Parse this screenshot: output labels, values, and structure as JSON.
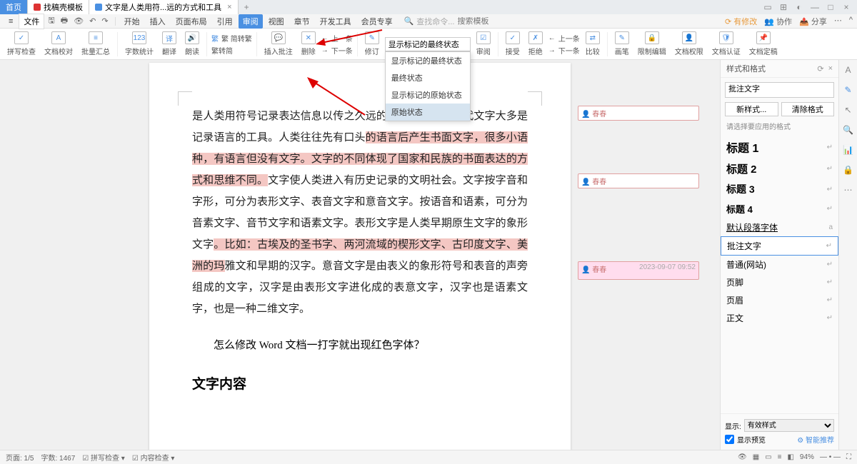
{
  "tabs": {
    "home": "首页",
    "t1": "找稿壳模板",
    "t2": "文字是人类用符...远的方式和工具"
  },
  "menu": {
    "file": "文件",
    "items": [
      "开始",
      "插入",
      "页面布局",
      "引用",
      "审阅",
      "视图",
      "章节",
      "开发工具",
      "会员专享"
    ],
    "active_index": 4,
    "search_label": "查找命令...",
    "search_placeholder": "搜索模板",
    "right": {
      "unsaved": "有修改",
      "coop": "协作",
      "share": "分享"
    }
  },
  "ribbon": {
    "g1": "拼写检查",
    "g2": "文档校对",
    "g3": "批量汇总",
    "g4": "字数统计",
    "g5": "翻译",
    "g6": "朗读",
    "simp": "繁 简转繁",
    "trad": "繁转简",
    "insert_comment": "插入批注",
    "delete": "删除",
    "prev": "上一条",
    "next": "下一条",
    "modify": "修订",
    "show_final_markup": "显示标记的最终状态",
    "review": "审阅",
    "accept": "接受",
    "reject": "拒绝",
    "prev2": "上一条",
    "next2": "下一条",
    "compare": "比较",
    "pen": "画笔",
    "restrict": "限制编辑",
    "perm": "文档权限",
    "auth": "文档认证",
    "anchor": "文档定稿"
  },
  "dropdown": {
    "i1": "显示标记的最终状态",
    "i2": "最终状态",
    "i3": "显示标记的原始状态",
    "i4": "原始状态"
  },
  "doc": {
    "p1a": "是人类用符号记录表达信息以传之久远的方式和工具。现代文字大多是记录语言的工具。人类往往先有口头",
    "p1b": "的语言后产生书面文字，很多小语种，有语言但没有文字。文字的不同体现了国家和民族的书面表达的方式和思维不同。",
    "p1c": "文字使人类进入有历史记录的文明社会。文字按字音和字形，可分为表形文字、表音文字和意音文字。按语音和语素，可分为音素文字、音节文字和语素文字。表形文字是人类早期原生文字的象形文字",
    "p1d": "。比如：古埃及的圣书字、两河流域的楔形文字、古印度文字、美洲的玛",
    "p1e": "雅文和早期的汉字。意音文字是由表义的象形符号和表音的声旁组成的文字，汉字是由表形文字进化成的表意文字，汉字也是语素文字，也是一种二维文字。",
    "q": "怎么修改 Word 文档一打字就出现红色字体？",
    "h2": "文字内容"
  },
  "comments": {
    "author": "春春",
    "ts": "2023-09-07 09:52"
  },
  "styles": {
    "title": "样式和格式",
    "combo": "批注文字",
    "new": "新样式...",
    "clear": "清除格式",
    "hint": "请选择要应用的格式",
    "items": [
      "标题 1",
      "标题 2",
      "标题 3",
      "标题 4",
      "默认段落字体",
      "批注文字",
      "普通(网站)",
      "页脚",
      "页眉",
      "正文"
    ],
    "selected_index": 5,
    "show": "显示:",
    "show_val": "有效样式",
    "preview": "显示预览",
    "smart": "智能推荐"
  },
  "status": {
    "page": "页面: 1/5",
    "words": "字数: 1467",
    "spell": "拼写检查",
    "content": "内容检查",
    "zoom": "94%"
  }
}
